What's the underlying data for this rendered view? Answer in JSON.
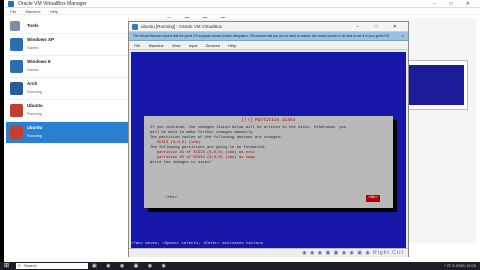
{
  "manager": {
    "title": "Oracle VM VirtualBox Manager",
    "window_controls": "– □ ✕",
    "menu": [
      "File",
      "Machine",
      "Help"
    ],
    "tools_label": "Tools",
    "vms": [
      {
        "name": "Windows XP",
        "state": "Saved",
        "os_color": "#2a6fb0"
      },
      {
        "name": "Windows 8",
        "state": "Saved",
        "os_color": "#2a6fb0"
      },
      {
        "name": "Arch",
        "state": "Running",
        "os_color": "#2b5c9a"
      },
      {
        "name": "Ubuntu",
        "state": "Running",
        "os_color": "#c04030"
      },
      {
        "name": "ubuntu",
        "state": "Running",
        "os_color": "#c04030",
        "selected": true
      }
    ]
  },
  "vm_window": {
    "title": "ubuntu [Running] - Oracle VM VirtualBox",
    "controls": "– □ ✕",
    "notice": "The Virtual Machine reports that the guest OS supports mouse pointer integration. This means that you do not need to capture the mouse pointer to be able to use it in your guest OS",
    "notice_close": "✕",
    "menu": [
      "File",
      "Machine",
      "View",
      "Input",
      "Devices",
      "Help"
    ]
  },
  "dialog": {
    "title": "[!!] Partition disks",
    "body_lines": [
      "If you continue, the changes listed below will be written to the disks. Otherwise, you",
      "will be able to make further changes manually.",
      "",
      "The partition tables of the following devices are changed:",
      "   SCSI3 (0,0,0) (sda)",
      "",
      "The following partitions are going to be formatted:",
      "   partition #1 of SCSI3 (0,0,0) (sda) as ext4",
      "   partition #5 of SCSI3 (0,0,0) (sda) as swap",
      "",
      "Write the changes to disks?"
    ],
    "no_label": "<Yes>",
    "yes_label": "<No>"
  },
  "vm_hint": "<Tab> moves; <Space> selects; <Enter> activates buttons",
  "status_icons": "◉ ◉ ◉ ▣ ▣ ◉ ◉ ▣ ◉ Right Ctrl",
  "taskbar": {
    "start_icon": "⊞",
    "search_icon": "⌕",
    "search_placeholder": "Search",
    "apps": "▣ ◉ ◉ ▣ ◉ ◉",
    "tray": "^ ⊡ ⊙ ENG 12:00"
  },
  "colors": {
    "selected_row": "#2a7fd0",
    "vm_screen": "#1616a8",
    "dialog_bg": "#b9b9b9",
    "dialog_accent": "#b00000",
    "taskbar": "#1d1d25"
  }
}
